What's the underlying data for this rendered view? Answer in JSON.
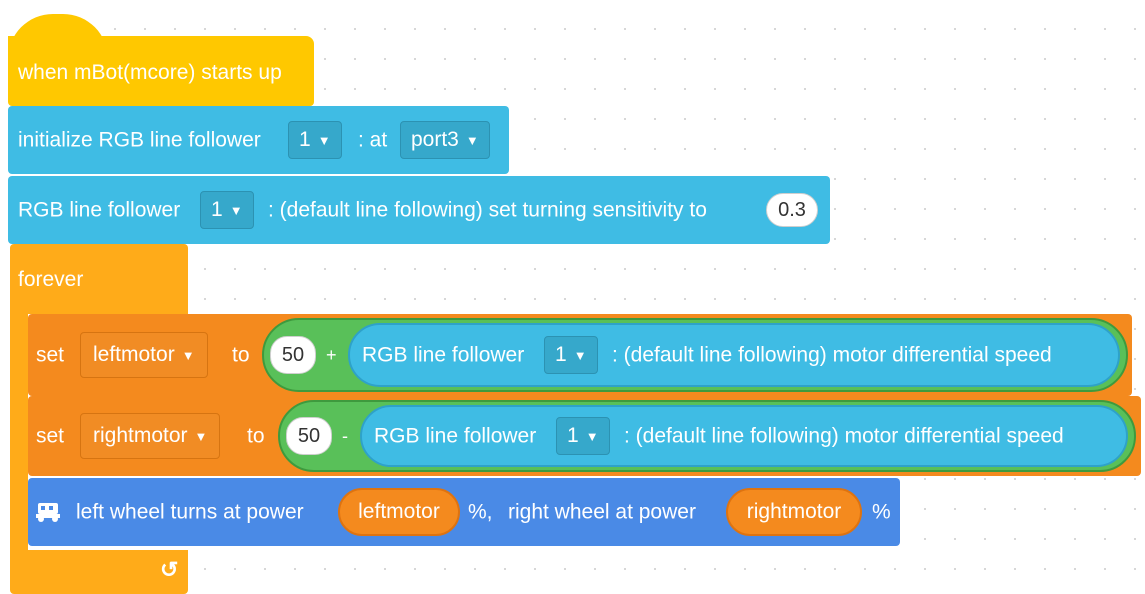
{
  "hat": {
    "label": "when mBot(mcore) starts up"
  },
  "init_block": {
    "label": "initialize RGB line follower",
    "index": "1",
    "at_label": ": at",
    "port": "port3"
  },
  "sensitivity_block": {
    "label": "RGB line follower",
    "index": "1",
    "suffix": ": (default line following) set turning sensitivity to",
    "value": "0.3"
  },
  "forever_block": {
    "label": "forever",
    "loop_arrow": "↺"
  },
  "set_left": {
    "set_label": "set",
    "variable": "leftmotor",
    "to_label": "to",
    "base_value": "50",
    "operator": "+",
    "reporter": {
      "label": "RGB line follower",
      "index": "1",
      "suffix": ": (default line following) motor differential speed"
    }
  },
  "set_right": {
    "set_label": "set",
    "variable": "rightmotor",
    "to_label": "to",
    "base_value": "50",
    "operator": "-",
    "reporter": {
      "label": "RGB line follower",
      "index": "1",
      "suffix": ": (default line following) motor differential speed"
    }
  },
  "wheel_block": {
    "icon": "mbot-robot-icon",
    "left_label": "left wheel turns at power",
    "left_var": "leftmotor",
    "percent1": "%,",
    "right_label": "right wheel at power",
    "right_var": "rightmotor",
    "percent2": "%"
  },
  "caret_char": "▼",
  "colors": {
    "events": "#ffc800",
    "control": "#ffab19",
    "rgb_sensor": "#3fbce4",
    "variables": "#f48a1e",
    "operators": "#59c059",
    "motion": "#4a8ae6"
  }
}
